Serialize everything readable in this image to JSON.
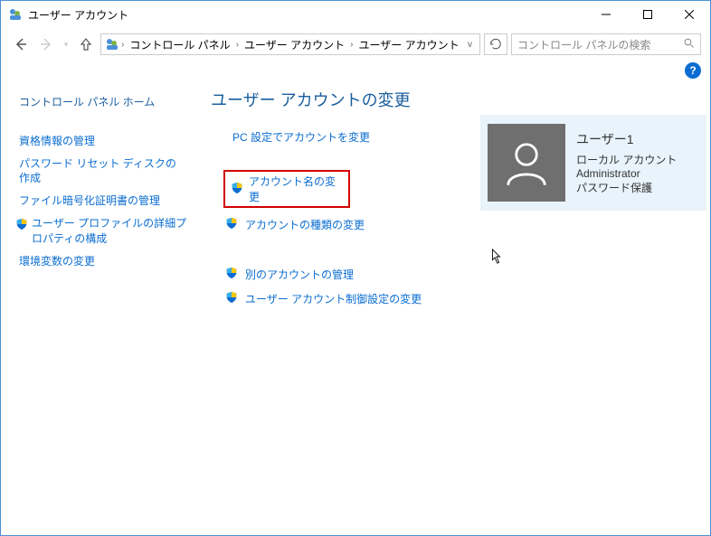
{
  "titlebar": {
    "title": "ユーザー アカウント"
  },
  "breadcrumb": {
    "items": [
      "コントロール パネル",
      "ユーザー アカウント",
      "ユーザー アカウント"
    ]
  },
  "search": {
    "placeholder": "コントロール パネルの検索"
  },
  "sidebar": {
    "home": "コントロール パネル ホーム",
    "items": [
      {
        "label": "資格情報の管理",
        "shield": false
      },
      {
        "label": "パスワード リセット ディスクの作成",
        "shield": false
      },
      {
        "label": "ファイル暗号化証明書の管理",
        "shield": false
      },
      {
        "label": "ユーザー プロファイルの詳細プロパティの構成",
        "shield": true
      },
      {
        "label": "環境変数の変更",
        "shield": false
      }
    ]
  },
  "main": {
    "title": "ユーザー アカウントの変更",
    "pc_settings": "PC 設定でアカウントを変更",
    "opts": {
      "change_name": "アカウント名の変更",
      "change_type": "アカウントの種類の変更",
      "manage_other": "別のアカウントの管理",
      "uac": "ユーザー アカウント制御設定の変更"
    }
  },
  "user_card": {
    "name": "ユーザー1",
    "type": "ローカル アカウント",
    "role": "Administrator",
    "pw": "パスワード保護"
  }
}
